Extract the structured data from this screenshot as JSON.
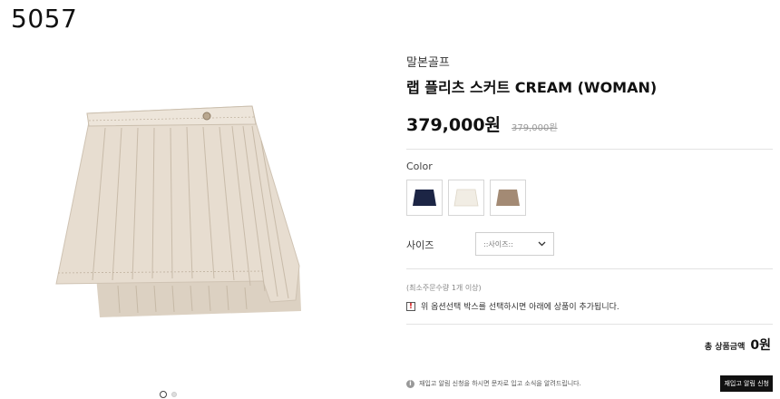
{
  "corner_id": "5057",
  "product": {
    "brand": "말본골프",
    "title": "랩 플리츠 스커트 CREAM (WOMAN)",
    "price": "379,000원",
    "original_price": "379,000원"
  },
  "colors": {
    "label": "Color",
    "options": [
      {
        "name": "navy",
        "hex": "#1c2545"
      },
      {
        "name": "cream",
        "hex": "#f1ede4"
      },
      {
        "name": "beige",
        "hex": "#a38a74"
      }
    ]
  },
  "size": {
    "label": "사이즈",
    "selected": "::사이즈::"
  },
  "min_qty_note": "(최소주문수량 1개 이상)",
  "option_notice": "위 옵션선택 박스를 선택하시면 아래에 상품이 추가됩니다.",
  "total": {
    "label": "총 상품금액",
    "value": "0원"
  },
  "restock": {
    "message": "재입고 알림 신청을 하시면 문자로 입고 소식을 알려드립니다.",
    "button": "재입고 알림 신청"
  }
}
